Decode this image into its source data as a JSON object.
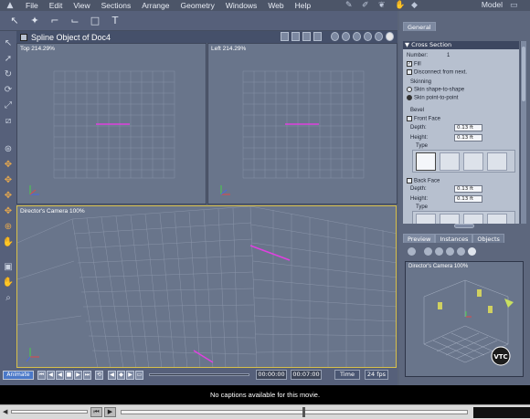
{
  "menu": {
    "items": [
      "File",
      "Edit",
      "View",
      "Sections",
      "Arrange",
      "Geometry",
      "Windows",
      "Web",
      "Help"
    ],
    "right_title": "Model"
  },
  "panel": {
    "title": "Spline Object of Doc4"
  },
  "viewports": {
    "top": {
      "label": "Top 214.29%"
    },
    "left": {
      "label": "Left 214.29%"
    },
    "camera": {
      "label": "Director's Camera 100%"
    }
  },
  "right_panel": {
    "tab_general": "General",
    "section_header": "Cross Section",
    "number_label": "Number:",
    "number_value": "1",
    "fill_label": "Fill",
    "disconnect_label": "Disconnect from next.",
    "skinning_label": "Skinning",
    "skin_shape": "Skin shape-to-shape",
    "skin_point": "Skin point-to-point",
    "bevel_label": "Bevel",
    "front_face": "Front Face",
    "depth_label": "Depth:",
    "height_label": "Height:",
    "front_depth": "0.13 ft",
    "front_height": "0.13 ft",
    "type_label": "Type",
    "back_face": "Back Face",
    "back_depth": "0.13 ft",
    "back_height": "0.13 ft"
  },
  "preview": {
    "tabs": [
      "Preview",
      "Instances",
      "Objects"
    ],
    "label": "Director's Camera 100%",
    "logo": "VTC"
  },
  "transport": {
    "animate": "Animate",
    "time_start": "00:00:00",
    "time_end": "00:07:00",
    "mode": "Time",
    "fps": "24 fps"
  },
  "caption": "No captions available for this movie.",
  "colors": {
    "accent": "#d8c04a",
    "spline": "#e040e0",
    "axis_x": "#e04848",
    "axis_y": "#48d048",
    "axis_z": "#4868e0"
  }
}
